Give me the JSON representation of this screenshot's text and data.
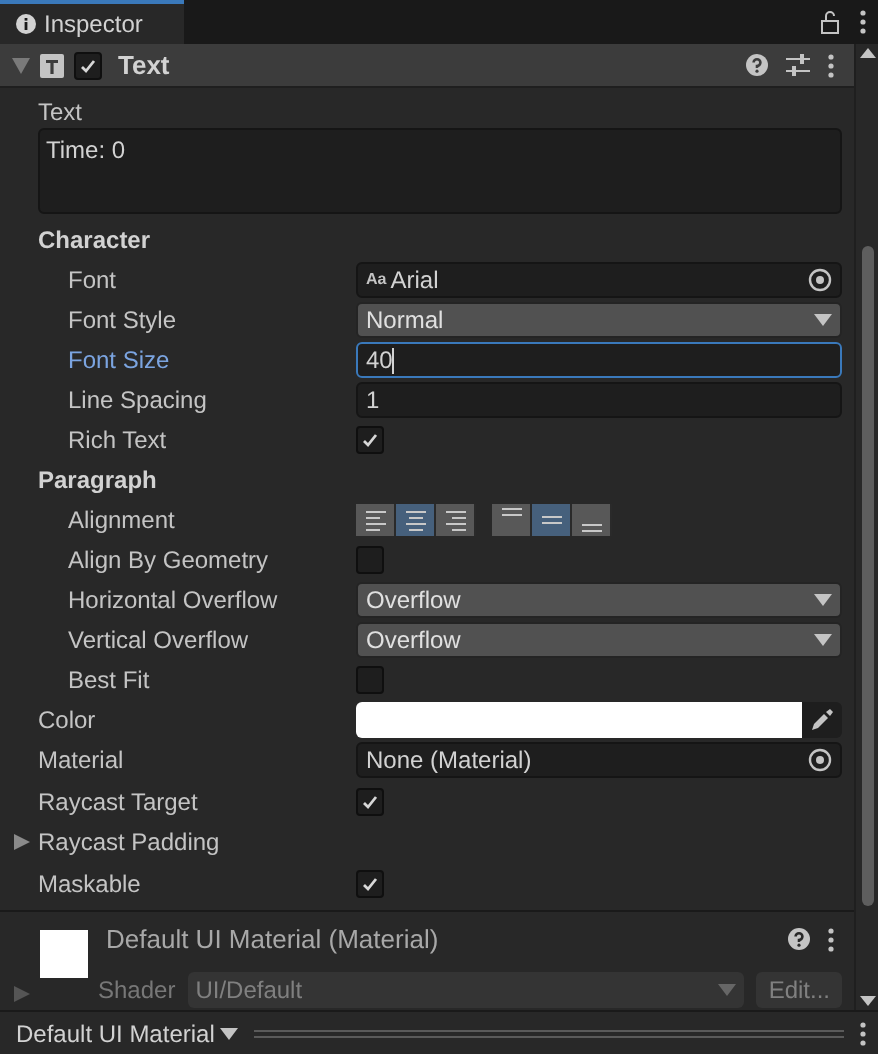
{
  "tab": {
    "title": "Inspector",
    "selected": true
  },
  "component": {
    "title": "Text",
    "expanded": true,
    "enabled": true
  },
  "text_field": {
    "label": "Text",
    "value": "Time: 0"
  },
  "properties": [
    {
      "kind": "section",
      "label": "Character",
      "children": [
        {
          "kind": "object",
          "label": "Font",
          "value": "Arial",
          "prefix": "Aa"
        },
        {
          "kind": "dropdown",
          "label": "Font Style",
          "value": "Normal"
        },
        {
          "kind": "number",
          "label": "Font Size",
          "value": "40",
          "focused": true
        },
        {
          "kind": "number",
          "label": "Line Spacing",
          "value": "1",
          "focused": false
        },
        {
          "kind": "checkbox",
          "label": "Rich Text",
          "checked": true
        }
      ]
    },
    {
      "kind": "section",
      "label": "Paragraph",
      "children": [
        {
          "kind": "alignment",
          "label": "Alignment",
          "horizontal": [
            {
              "selected": false
            },
            {
              "selected": true
            },
            {
              "selected": false
            }
          ],
          "vertical": [
            {
              "selected": false
            },
            {
              "selected": true
            },
            {
              "selected": false
            }
          ]
        },
        {
          "kind": "checkbox",
          "label": "Align By Geometry",
          "checked": false
        },
        {
          "kind": "dropdown",
          "label": "Horizontal Overflow",
          "value": "Overflow"
        },
        {
          "kind": "dropdown",
          "label": "Vertical Overflow",
          "value": "Overflow"
        },
        {
          "kind": "checkbox",
          "label": "Best Fit",
          "checked": false
        }
      ]
    },
    {
      "kind": "color",
      "label": "Color",
      "color": "#ffffff"
    },
    {
      "kind": "object",
      "label": "Material",
      "value": "None (Material)"
    },
    {
      "kind": "checkbox",
      "label": "Raycast Target",
      "checked": true
    },
    {
      "kind": "foldout",
      "label": "Raycast Padding",
      "expanded": false
    },
    {
      "kind": "checkbox",
      "label": "Maskable",
      "checked": true
    }
  ],
  "material": {
    "title": "Default UI Material (Material)",
    "shader_label": "Shader",
    "shader": "UI/Default",
    "edit_button": "Edit..."
  },
  "bottom_bar": {
    "label": "Default UI Material"
  }
}
